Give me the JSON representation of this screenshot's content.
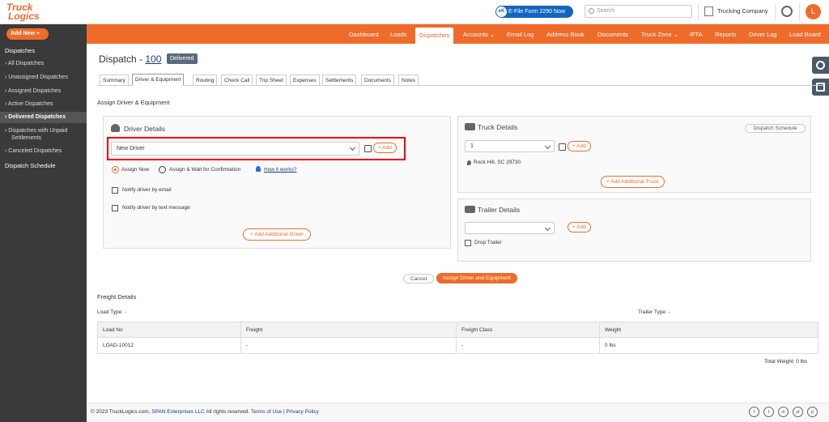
{
  "topbar": {
    "logo_line1": "Truck",
    "logo_line2": "Logics",
    "efile_badge": "eK",
    "efile_label": "E-File Form 2290 Now",
    "search_placeholder": "Search",
    "company": "Trucking Company",
    "avatar_initial": "L"
  },
  "sidebar": {
    "add_new": "Add New +",
    "section": "Dispatches",
    "items": [
      "› All Dispatches",
      "› Unassigned Dispatches",
      "› Assigned Dispatches",
      "› Active Dispatches",
      "› Delivered Dispatches",
      "› Dispatches with Unpaid",
      "Settlements",
      "› Canceled Dispatches"
    ],
    "schedule": "Dispatch Schedule"
  },
  "nav": [
    "Dashboard",
    "Loads",
    "Dispatches",
    "Accounts ⌄",
    "Email Log",
    "Address Book",
    "Documents",
    "Truck Zone ⌄",
    "IFTA",
    "Reports",
    "Driver Log",
    "Load Board"
  ],
  "page": {
    "title_prefix": "Dispatch - ",
    "dispatch_no": "100",
    "status": "Delivered"
  },
  "tabs": [
    "Summary",
    "Driver & Equipment",
    "Routing",
    "Check Call",
    "Trip Sheet",
    "Expenses",
    "Settlements",
    "Documents",
    "Notes"
  ],
  "assign_section": "Assign Driver & Equipment",
  "driver": {
    "title": "Driver Details",
    "selected": "New Driver",
    "add": "+ Add",
    "assign_now": "Assign Now",
    "assign_wait": "Assign & Wait for Confirmation",
    "how_it_works": "How it works?",
    "notify_email": "Notify driver by email",
    "notify_text": "Notify driver by text message",
    "add_additional": "+ Add Additional Driver"
  },
  "truck": {
    "title": "Truck Details",
    "schedule_btn": "Dispatch Schedule",
    "selected": "1",
    "add": "+ Add",
    "location": "Rock Hill, SC 29730",
    "add_additional": "+ Add Additional Truck"
  },
  "trailer": {
    "title": "Trailer Details",
    "selected": "",
    "add": "+ Add",
    "drop_trailer": "Drop Trailer"
  },
  "actions": {
    "cancel": "Cancel",
    "assign": "Assign Driver and Equipment"
  },
  "freight": {
    "title": "Freight Details",
    "load_type": "Load Type: -",
    "trailer_type": "Trailer Type: -",
    "headers": [
      "Load No",
      "Freight",
      "Freight Class",
      "Weight"
    ],
    "row": [
      "LOAD-10012",
      "-",
      "-",
      "0 lbs"
    ],
    "total_weight": "Total Weight:   0 lbs"
  },
  "footer": {
    "copyright": "© 2023 TruckLogics.com, ",
    "span": "SPAN Enterprises LLC",
    "rights": " All rights reserved. ",
    "terms": "Terms of Use",
    "divider": " | ",
    "privacy": "Privacy Policy",
    "social": [
      "f",
      "t",
      "in",
      "yt",
      "p"
    ]
  }
}
